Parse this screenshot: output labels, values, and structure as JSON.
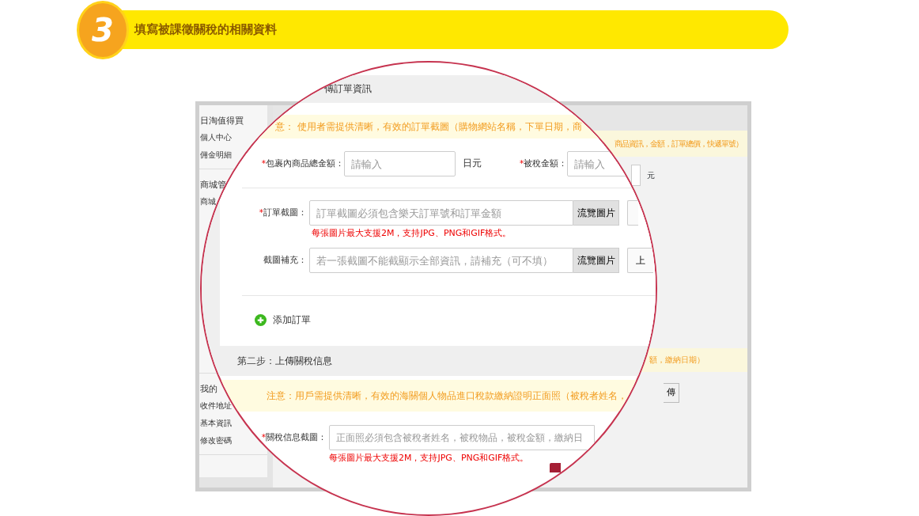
{
  "header": {
    "step": "3",
    "title": "填寫被課徵關稅的相關資料"
  },
  "background": {
    "sidebar": [
      {
        "title": "日淘值得買",
        "items": [
          "個人中心",
          "佣金明細"
        ]
      },
      {
        "title": "商城管",
        "items": [
          "商城"
        ]
      },
      {
        "title": "我的",
        "items": [
          "收件地址",
          "基本資訊",
          "修改密碼"
        ]
      }
    ],
    "notice_1_tail": "商品資訊，金額，訂單總價，快遞單號）",
    "unit": "元",
    "notice_2_tail": "額，繳納日期）",
    "upload_button_tail": "傳"
  },
  "magnified": {
    "section_1": {
      "title": "傳訂單資訊",
      "notice": "意： 使用者需提供清晰，有效的訂單截圖（購物網站名稱，下單日期，商",
      "amount_fields": [
        {
          "mark": "*",
          "label": "包裹內商品總金額：",
          "placeholder": "請輸入",
          "unit": "日元"
        },
        {
          "mark": "*",
          "label": "被稅金額：",
          "placeholder": "請輸入"
        }
      ],
      "upload_fields": [
        {
          "mark": "*",
          "label": "訂單截圖：",
          "placeholder": "訂單截圖必須包含樂天訂單號和訂單金額",
          "browse": "流覽圖片",
          "hint": "每張圖片最大支援2M，支持JPG、PNG和GIF格式。"
        },
        {
          "label": "截圖補充：",
          "placeholder": "若一張截圖不能截顯示全部資訊，請補充（可不填）",
          "browse": "流覽圖片",
          "upload": "上"
        }
      ],
      "add_order": "添加訂單"
    },
    "section_2": {
      "title": "第二步：上傳關稅信息",
      "notice": "注意：用戶需提供清晰，有效的海關個人物品進口稅款繳納證明正面照（被稅者姓名，",
      "upload_field": {
        "mark": "*",
        "label": "關稅信息截圖：",
        "placeholder": "正面照必須包含被稅者姓名，被稅物品，被稅金額，繳納日",
        "hint": "每張圖片最大支援2M，支持JPG、PNG和GIF格式。"
      }
    }
  }
}
